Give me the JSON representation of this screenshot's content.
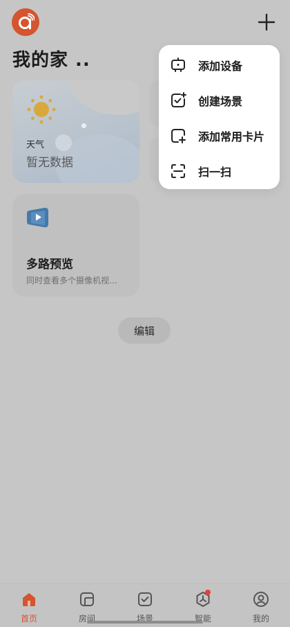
{
  "header": {
    "logo_icon": "app-logo-icon",
    "add_icon": "plus-icon"
  },
  "home": {
    "title": "我的家 .."
  },
  "weather_card": {
    "icon": "sun-icon",
    "label": "天气",
    "status": "暂无数据"
  },
  "camera_card": {
    "icon": "play-video-icon",
    "title": "多路预览",
    "description": "同时查看多个摄像机视…"
  },
  "edit_button": {
    "label": "编辑"
  },
  "dropdown_menu": {
    "items": [
      {
        "icon": "device-icon",
        "label": "添加设备"
      },
      {
        "icon": "scene-add-icon",
        "label": "创建场景"
      },
      {
        "icon": "card-add-icon",
        "label": "添加常用卡片"
      },
      {
        "icon": "scan-icon",
        "label": "扫一扫"
      }
    ]
  },
  "bottom_nav": {
    "items": [
      {
        "icon": "home-icon",
        "label": "首页",
        "active": true
      },
      {
        "icon": "room-icon",
        "label": "房间"
      },
      {
        "icon": "scene-icon",
        "label": "场景"
      },
      {
        "icon": "smart-icon",
        "label": "智能",
        "badge": true
      },
      {
        "icon": "profile-icon",
        "label": "我的"
      }
    ]
  },
  "colors": {
    "accent": "#d4552f",
    "overlay_bg": "#c6c6c6",
    "menu_bg": "#ffffff",
    "badge": "#e5403c"
  }
}
